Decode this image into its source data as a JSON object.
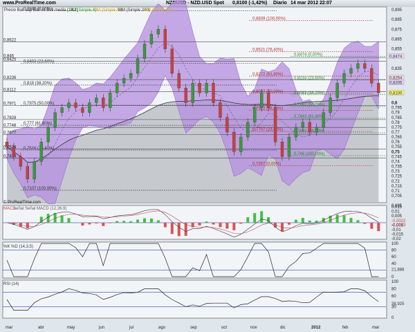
{
  "header": {
    "site": "www.ProRealTime.com",
    "title": "NZDUSD - NZD.USD Spot",
    "change": "0,8100 (-1,42%)",
    "period": "Diario",
    "datetime": "14 mar 2012 22:07"
  },
  "legend": {
    "main": "Precio Boll sup Boll inf Boll media (18,2)",
    "sma4": "MM (Simple 4)",
    "sma50": "MM (Simple 50)",
    "sma200": "MM (Simple 200)",
    "sma55": "MM (Simple 55)",
    "copyright": "© ProRealTime.com",
    "macd": "MACD",
    "macd_signal": "señal Señal MACD (12,26,9)",
    "stoch": "%K %D (14,3,5)",
    "rsi": "RSI (14)"
  },
  "colors": {
    "band": "#b48ee0",
    "up": "#3a9a3a",
    "down": "#c84040",
    "gray": "#c6cacf",
    "fib_black": "#333333",
    "fib_red": "#b03030",
    "fib_green": "#2a8a2a"
  },
  "chart_data": {
    "type": "candlestick",
    "title": "NZDUSD - NZD.USD Spot",
    "ylim": [
      0.695,
      0.895
    ],
    "x_ticks": [
      "mar",
      "abr",
      "may",
      "jun",
      "jul",
      "ago",
      "sep",
      "oct",
      "nov",
      "dic",
      "2012",
      "feb",
      "mar"
    ],
    "y_ticks": [
      "0,895",
      "0,885",
      "0,875",
      "0,865",
      "0,855",
      "0,835",
      "0,8",
      "0,795",
      "0,79",
      "0,785",
      "0,78",
      "0,775",
      "0,77",
      "0,765",
      "0,76",
      "0,755",
      "0,75",
      "0,745",
      "0,74",
      "0,735",
      "0,73",
      "0,725",
      "0,72",
      "0,715",
      "0,71",
      "0,705",
      "0,695"
    ],
    "y_tick_values": [
      0.895,
      0.885,
      0.875,
      0.865,
      0.855,
      0.835,
      0.8,
      0.795,
      0.79,
      0.785,
      0.78,
      0.775,
      0.77,
      0.765,
      0.76,
      0.755,
      0.75,
      0.745,
      0.74,
      0.735,
      0.73,
      0.725,
      0.72,
      0.715,
      0.71,
      0.705,
      0.695
    ],
    "closes": [
      0.755,
      0.745,
      0.735,
      0.722,
      0.74,
      0.76,
      0.775,
      0.79,
      0.795,
      0.8,
      0.795,
      0.79,
      0.8,
      0.805,
      0.795,
      0.81,
      0.82,
      0.825,
      0.83,
      0.845,
      0.86,
      0.87,
      0.875,
      0.855,
      0.83,
      0.815,
      0.8,
      0.82,
      0.81,
      0.82,
      0.8,
      0.785,
      0.77,
      0.75,
      0.765,
      0.78,
      0.795,
      0.81,
      0.795,
      0.76,
      0.745,
      0.765,
      0.775,
      0.78,
      0.77,
      0.775,
      0.79,
      0.805,
      0.82,
      0.83,
      0.835,
      0.84,
      0.835,
      0.82,
      0.81
    ],
    "left_levels": [
      {
        "v": 0.8622,
        "l": "0,8622"
      },
      {
        "v": 0.846,
        "l": "0,846"
      },
      {
        "v": 0.8425,
        "l": "0,8425"
      },
      {
        "v": 0.8236,
        "l": "0,8236"
      },
      {
        "v": 0.8112,
        "l": "0,8112"
      },
      {
        "v": 0.7971,
        "l": "0,7971"
      },
      {
        "v": 0.7828,
        "l": "0,7828"
      },
      {
        "v": 0.7748,
        "l": "0,7748"
      },
      {
        "v": 0.7677,
        "l": "0,7677"
      },
      {
        "v": 0.7526,
        "l": "0,7526"
      },
      {
        "v": 0.7434,
        "l": "0,7434"
      }
    ],
    "fib_black": [
      {
        "v": 0.894,
        "l": "0,8940 (0,00%)"
      },
      {
        "v": 0.8403,
        "l": "0,8403 (23,60%)"
      },
      {
        "v": 0.818,
        "l": "0,818 (38,20%)"
      },
      {
        "v": 0.7975,
        "l": "0,7975 (50,00%)"
      },
      {
        "v": 0.777,
        "l": "0,777 (61,80%)"
      },
      {
        "v": 0.7516,
        "l": "0,7516 (76,40%)"
      },
      {
        "v": 0.7107,
        "l": "0,7107 (100,00%)"
      }
    ],
    "fib_red": [
      {
        "v": 0.8839,
        "l": "0,8839 (100,00%)"
      },
      {
        "v": 0.8521,
        "l": "0,8521 (76,40%)"
      },
      {
        "v": 0.8272,
        "l": "0,8272 (61,80%)"
      },
      {
        "v": 0.8097,
        "l": "0,8097 (50,00%)"
      },
      {
        "v": 0.7922,
        "l": "0,7922 (38,20%)"
      },
      {
        "v": 0.7707,
        "l": "0,7707 (23,60%)"
      },
      {
        "v": 0.7357,
        "l": "0,7357 (0,00%)"
      }
    ],
    "fib_green": [
      {
        "v": 0.8474,
        "l": "0,8474 (0,00%)"
      },
      {
        "v": 0.8233,
        "l": "0,8233 (23,60%)"
      },
      {
        "v": 0.8083,
        "l": "0,8083 (38,20%)"
      },
      {
        "v": 0.7962,
        "l": "0,7962 (50,00%)"
      },
      {
        "v": 0.7842,
        "l": "0,7842 (61,80%)"
      },
      {
        "v": 0.7692,
        "l": "0,7692 (76,40%)"
      },
      {
        "v": 0.746,
        "l": "0,746 (100,00%)"
      }
    ],
    "badges": [
      {
        "v": 0.8474,
        "l": "0,8474",
        "c": "#e8dcf6"
      },
      {
        "v": 0.8254,
        "l": "0,8254",
        "c": "#f4d8e8"
      },
      {
        "v": 0.8205,
        "l": "0,8205",
        "c": "#e0d0f4"
      },
      {
        "v": 0.81,
        "l": "0,8100",
        "c": "#f4f070"
      }
    ],
    "macd": {
      "ticks": [
        "0,015",
        "0,01",
        "0,005",
        "-0,005",
        "-0,01",
        "-0,015",
        "-0,02"
      ],
      "readouts": [
        "-0,0022",
        "-0,0023"
      ]
    },
    "stoch": {
      "ticks": [
        "100",
        "80",
        "60",
        "40",
        "0"
      ],
      "readout": "21,888"
    },
    "rsi": {
      "ticks": [
        "100",
        "80",
        "60",
        "30",
        "0"
      ],
      "readout": "38,925"
    }
  }
}
